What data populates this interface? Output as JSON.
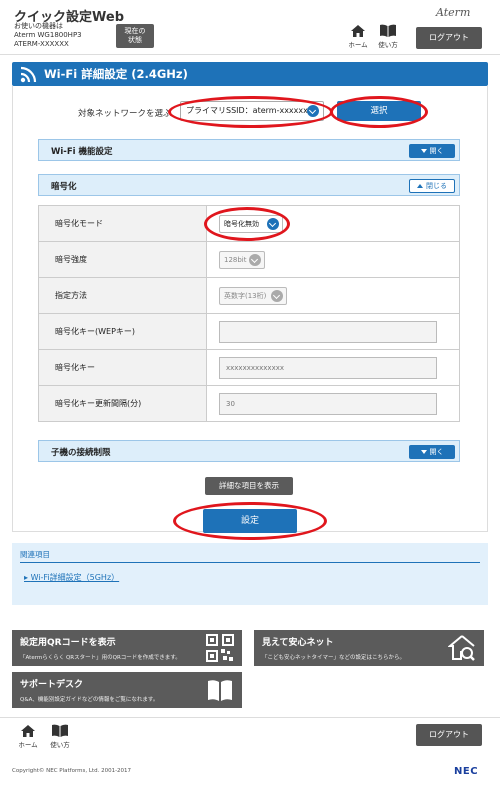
{
  "header": {
    "app_title": "クイック設定Web",
    "device_label": "お使いの機器は",
    "device_model": "Aterm WG1800HP3",
    "device_id": "ATERM-XXXXXX",
    "status_button": "現在の\n状態",
    "logo": "Aterm",
    "home_label": "ホーム",
    "manual_label": "使い方",
    "logout_label": "ログアウト"
  },
  "page": {
    "title": "Wi-Fi 詳細設定 (2.4GHz)",
    "network_label": "対象ネットワークを選ぶ",
    "network_value": "プライマリSSID：aterm-xxxxxx-g",
    "select_button": "選択"
  },
  "sections": {
    "wifi_function": {
      "title": "Wi-Fi 機能設定",
      "toggle": "開く"
    },
    "encryption": {
      "title": "暗号化",
      "toggle": "閉じる"
    },
    "child_limit": {
      "title": "子機の接続制限",
      "toggle": "開く"
    }
  },
  "encryption": {
    "rows": [
      {
        "label": "暗号化モード",
        "value": "暗号化無効"
      },
      {
        "label": "暗号強度",
        "value": "128bit"
      },
      {
        "label": "指定方法",
        "value": "英数字(13桁)"
      },
      {
        "label": "暗号化キー(WEPキー)",
        "value": ""
      },
      {
        "label": "暗号化キー",
        "value": "xxxxxxxxxxxxxx"
      },
      {
        "label": "暗号化キー更新間隔(分)",
        "value": "30"
      }
    ]
  },
  "actions": {
    "detail_button": "詳細な項目を表示",
    "setting_button": "設定"
  },
  "related": {
    "heading": "関連項目",
    "link": "Wi-Fi詳細設定（5GHz）"
  },
  "cards": [
    {
      "title": "設定用QRコードを表示",
      "subtitle": "「Atermらくらく QRスタート」用のQRコードを作成できます。",
      "icon": "qr-code-icon"
    },
    {
      "title": "見えて安心ネット",
      "subtitle": "「こども安心ネットタイマー」などの設定はこちらから。",
      "icon": "home-search-icon"
    },
    {
      "title": "サポートデスク",
      "subtitle": "Q&A、機能別設定ガイドなどの情報をご覧になれます。",
      "icon": "book-icon"
    }
  ],
  "footer": {
    "copyright": "Copyright© NEC Platforms, Ltd. 2001-2017",
    "nec": "NEC"
  },
  "colors": {
    "accent": "#1e72b8",
    "dark_button": "#5b5b5b",
    "highlight_ring": "#e0161d",
    "section_bg": "#ddeefa"
  }
}
